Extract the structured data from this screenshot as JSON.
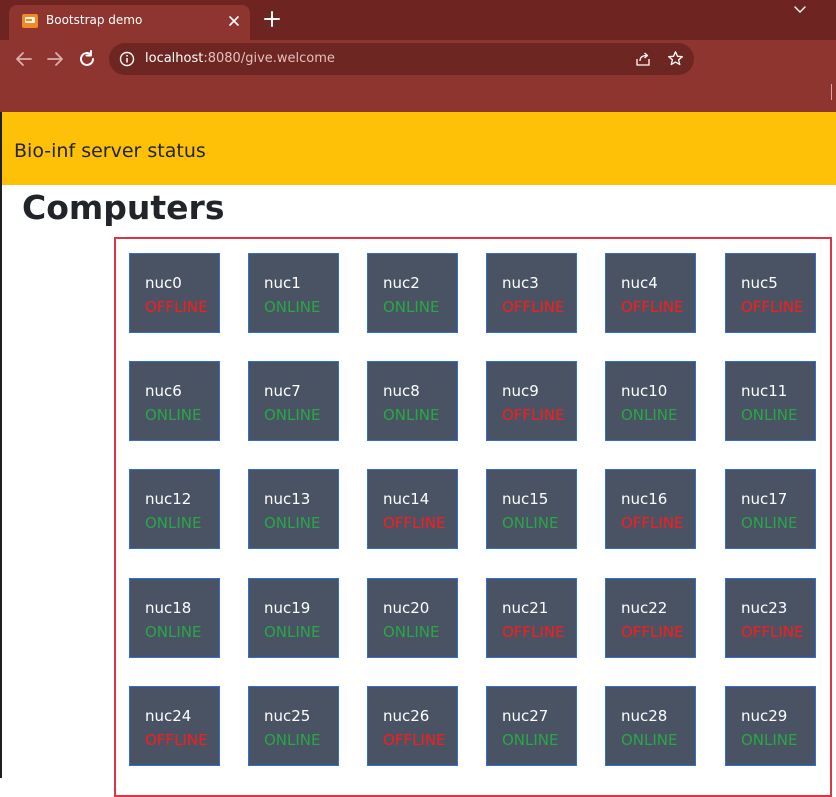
{
  "browser": {
    "tab_title": "Bootstrap demo",
    "url_host": "localhost",
    "url_path": ":8080/give.welcome",
    "icons": [
      "app-favicon-icon",
      "close-icon",
      "plus-icon",
      "chevron-down-icon",
      "back-arrow-icon",
      "forward-arrow-icon",
      "reload-icon",
      "site-info-icon",
      "share-icon",
      "star-icon"
    ]
  },
  "navbar": {
    "brand": "Bio-inf server status",
    "color": "#ffc107"
  },
  "page": {
    "heading": "Computers"
  },
  "colors": {
    "online": "#28a745",
    "offline": "#ff1a1a",
    "card_bg": "#495363",
    "card_border": "#2d6fd6",
    "frame_border": "#dc3545"
  },
  "computers": [
    {
      "name": "nuc0",
      "status": "OFFLINE"
    },
    {
      "name": "nuc1",
      "status": "ONLINE"
    },
    {
      "name": "nuc2",
      "status": "ONLINE"
    },
    {
      "name": "nuc3",
      "status": "OFFLINE"
    },
    {
      "name": "nuc4",
      "status": "OFFLINE"
    },
    {
      "name": "nuc5",
      "status": "OFFLINE"
    },
    {
      "name": "nuc6",
      "status": "ONLINE"
    },
    {
      "name": "nuc7",
      "status": "ONLINE"
    },
    {
      "name": "nuc8",
      "status": "ONLINE"
    },
    {
      "name": "nuc9",
      "status": "OFFLINE"
    },
    {
      "name": "nuc10",
      "status": "ONLINE"
    },
    {
      "name": "nuc11",
      "status": "ONLINE"
    },
    {
      "name": "nuc12",
      "status": "ONLINE"
    },
    {
      "name": "nuc13",
      "status": "ONLINE"
    },
    {
      "name": "nuc14",
      "status": "OFFLINE"
    },
    {
      "name": "nuc15",
      "status": "ONLINE"
    },
    {
      "name": "nuc16",
      "status": "OFFLINE"
    },
    {
      "name": "nuc17",
      "status": "ONLINE"
    },
    {
      "name": "nuc18",
      "status": "ONLINE"
    },
    {
      "name": "nuc19",
      "status": "ONLINE"
    },
    {
      "name": "nuc20",
      "status": "ONLINE"
    },
    {
      "name": "nuc21",
      "status": "OFFLINE"
    },
    {
      "name": "nuc22",
      "status": "OFFLINE"
    },
    {
      "name": "nuc23",
      "status": "OFFLINE"
    },
    {
      "name": "nuc24",
      "status": "OFFLINE"
    },
    {
      "name": "nuc25",
      "status": "ONLINE"
    },
    {
      "name": "nuc26",
      "status": "OFFLINE"
    },
    {
      "name": "nuc27",
      "status": "ONLINE"
    },
    {
      "name": "nuc28",
      "status": "ONLINE"
    },
    {
      "name": "nuc29",
      "status": "ONLINE"
    }
  ]
}
